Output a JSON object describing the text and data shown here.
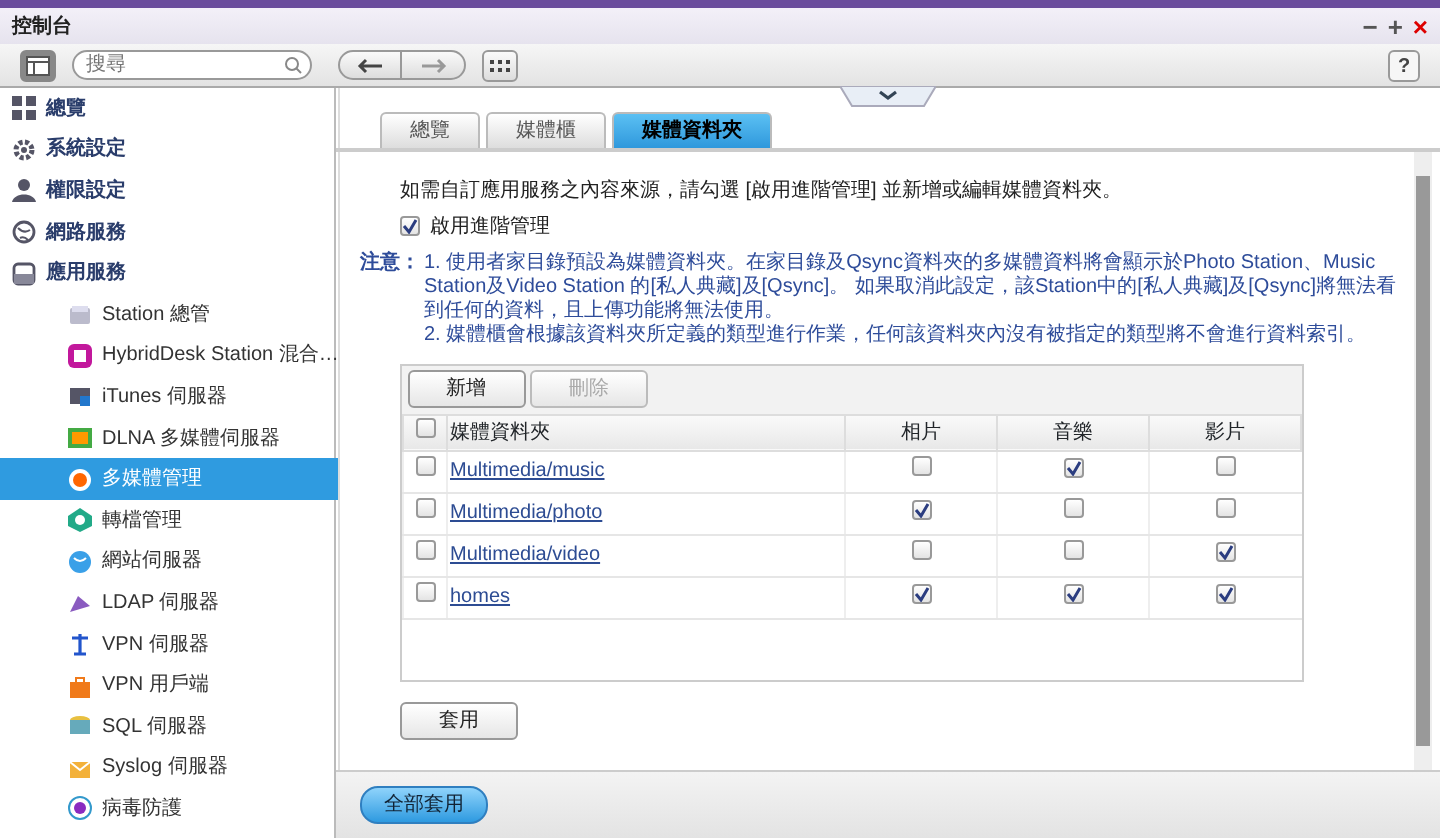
{
  "window": {
    "title": "控制台",
    "controls": [
      "−",
      "+",
      "×"
    ],
    "help": "?"
  },
  "toolbar": {
    "search": {
      "placeholder": "搜尋"
    }
  },
  "sidebar": {
    "items": [
      {
        "label": "總覽",
        "selected": false
      },
      {
        "label": "系統設定",
        "selected": false
      },
      {
        "label": "權限設定",
        "selected": false
      },
      {
        "label": "網路服務",
        "selected": false
      },
      {
        "label": "應用服務",
        "selected": false,
        "children": [
          {
            "label": "Station 總管",
            "selected": false
          },
          {
            "label": "HybridDesk Station 混合…",
            "selected": false
          },
          {
            "label": "iTunes 伺服器",
            "selected": false
          },
          {
            "label": "DLNA 多媒體伺服器",
            "selected": false
          },
          {
            "label": "多媒體管理",
            "selected": true
          },
          {
            "label": "轉檔管理",
            "selected": false
          },
          {
            "label": "網站伺服器",
            "selected": false
          },
          {
            "label": "LDAP 伺服器",
            "selected": false
          },
          {
            "label": "VPN 伺服器",
            "selected": false
          },
          {
            "label": "VPN 用戶端",
            "selected": false
          },
          {
            "label": "SQL 伺服器",
            "selected": false
          },
          {
            "label": "Syslog 伺服器",
            "selected": false
          },
          {
            "label": "病毒防護",
            "selected": false
          }
        ]
      }
    ]
  },
  "tabs": [
    {
      "label": "總覽",
      "selected": false
    },
    {
      "label": "媒體櫃",
      "selected": false
    },
    {
      "label": "媒體資料夾",
      "selected": true
    }
  ],
  "intro": "如需自訂應用服務之內容來源，請勾選 [啟用進階管理] 並新增或編輯媒體資料夾。",
  "advanced": {
    "label": "啟用進階管理",
    "checked": true
  },
  "note": {
    "label": "注意：",
    "items": [
      "1. 使用者家目錄預設為媒體資料夾。在家目錄及Qsync資料夾的多媒體資料將會顯示於Photo Station、Music Station及Video Station 的[私人典藏]及[Qsync]。 如果取消此設定，該Station中的[私人典藏]及[Qsync]將無法看到任何的資料，且上傳功能將無法使用。",
      "2. 媒體櫃會根據該資料夾所定義的類型進行作業，任何該資料夾內沒有被指定的類型將不會進行資料索引。"
    ]
  },
  "table_buttons": [
    {
      "label": "新增",
      "disabled": false
    },
    {
      "label": "刪除",
      "disabled": true
    }
  ],
  "table": {
    "select_all": false,
    "columns": [
      "媒體資料夾",
      "相片",
      "音樂",
      "影片"
    ],
    "rows": [
      {
        "checked": false,
        "folder": "Multimedia/music",
        "photo": false,
        "music": true,
        "video": false
      },
      {
        "checked": false,
        "folder": "Multimedia/photo",
        "photo": true,
        "music": false,
        "video": false
      },
      {
        "checked": false,
        "folder": "Multimedia/video",
        "photo": false,
        "music": false,
        "video": true
      },
      {
        "checked": false,
        "folder": "homes",
        "photo": true,
        "music": true,
        "video": true
      }
    ]
  },
  "apply": "套用",
  "footer": {
    "apply_all": "全部套用"
  }
}
